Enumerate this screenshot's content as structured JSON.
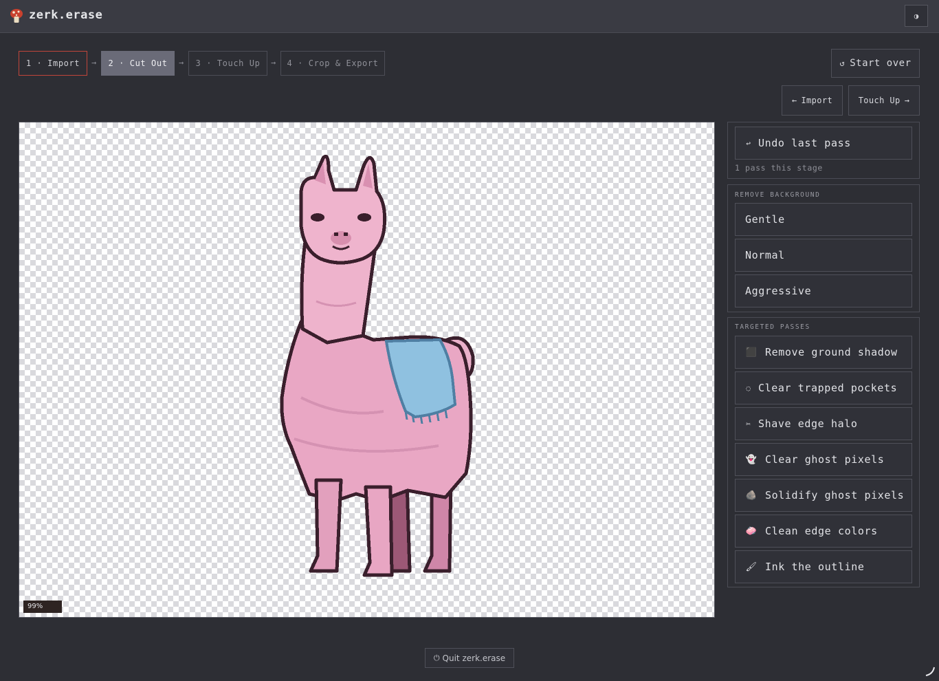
{
  "app": {
    "title": "zerk.erase",
    "logo_icon": "mushroom-icon",
    "theme_icon": "◑"
  },
  "steps": [
    {
      "label": "1 · Import",
      "state": "done"
    },
    {
      "label": "2 · Cut Out",
      "state": "active"
    },
    {
      "label": "3 · Touch Up",
      "state": "pending"
    },
    {
      "label": "4 · Crop & Export",
      "state": "pending"
    }
  ],
  "step_arrow": "→",
  "header_actions": {
    "start_over_icon": "↺",
    "start_over": "Start over"
  },
  "nav": {
    "back_icon": "←",
    "back": "Import",
    "next": "Touch Up",
    "next_icon": "→"
  },
  "canvas": {
    "zoom": "99%"
  },
  "undo": {
    "icon": "↩",
    "label": "Undo last pass",
    "pass_count": "1 pass this stage"
  },
  "remove_background": {
    "title": "REMOVE BACKGROUND",
    "options": [
      "Gentle",
      "Normal",
      "Aggressive"
    ]
  },
  "targeted_passes": {
    "title": "TARGETED PASSES",
    "items": [
      {
        "icon": "⬛",
        "label": "Remove ground shadow"
      },
      {
        "icon": "◌",
        "label": "Clear trapped pockets"
      },
      {
        "icon": "✂",
        "label": "Shave edge halo"
      },
      {
        "icon": "👻",
        "label": "Clear ghost pixels"
      },
      {
        "icon": "🪨",
        "label": "Solidify ghost pixels"
      },
      {
        "icon": "🧼",
        "label": "Clean edge colors"
      },
      {
        "icon": "🖌",
        "label": "Ink the outline"
      }
    ]
  },
  "footer": {
    "quit_icon": "⏻",
    "quit": "Quit zerk.erase"
  },
  "colors": {
    "accent_done": "#c2463a",
    "active_step": "#6a6b78",
    "llama_pink": "#e7a5c3",
    "blanket_blue": "#8fc1e0"
  }
}
